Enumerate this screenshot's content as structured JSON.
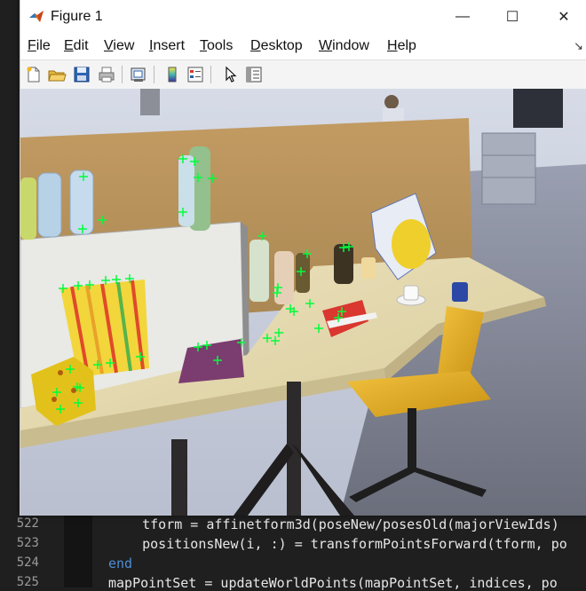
{
  "window": {
    "title": "Figure 1",
    "minimize_symbol": "—",
    "maximize_symbol": "☐",
    "close_symbol": "✕"
  },
  "menubar": {
    "items": [
      {
        "label": "File",
        "accel": "F",
        "rest": "ile"
      },
      {
        "label": "Edit",
        "accel": "E",
        "rest": "dit"
      },
      {
        "label": "View",
        "accel": "V",
        "rest": "iew"
      },
      {
        "label": "Insert",
        "accel": "I",
        "rest": "nsert"
      },
      {
        "label": "Tools",
        "accel": "T",
        "rest": "ools"
      },
      {
        "label": "Desktop",
        "accel": "D",
        "rest": "esktop"
      },
      {
        "label": "Window",
        "accel": "W",
        "rest": "indow"
      },
      {
        "label": "Help",
        "accel": "H",
        "rest": "elp"
      }
    ],
    "dock_symbol": "↘"
  },
  "toolbar": {
    "icons": [
      "new-figure-icon",
      "open-file-icon",
      "save-icon",
      "print-icon",
      "link-plot-icon",
      "colorbar-icon",
      "legend-icon",
      "pointer-icon",
      "property-inspector-icon"
    ]
  },
  "editor": {
    "lines": [
      {
        "num": "522",
        "code": "    tform = affinetform3d(poseNew/posesOld(majorViewIds)"
      },
      {
        "num": "523",
        "code": "    positionsNew(i, :) = transformPointsForward(tform, po"
      },
      {
        "num": "524",
        "code": "end",
        "keyword": true
      },
      {
        "num": "525",
        "code": "mapPointSet = updateWorldPoints(mapPointSet, indices, po"
      }
    ],
    "hidden_line_prefix": "5"
  },
  "colors": {
    "marker": "#00ff3c",
    "keyword": "#4e8dd6"
  },
  "feature_markers_count": 64
}
